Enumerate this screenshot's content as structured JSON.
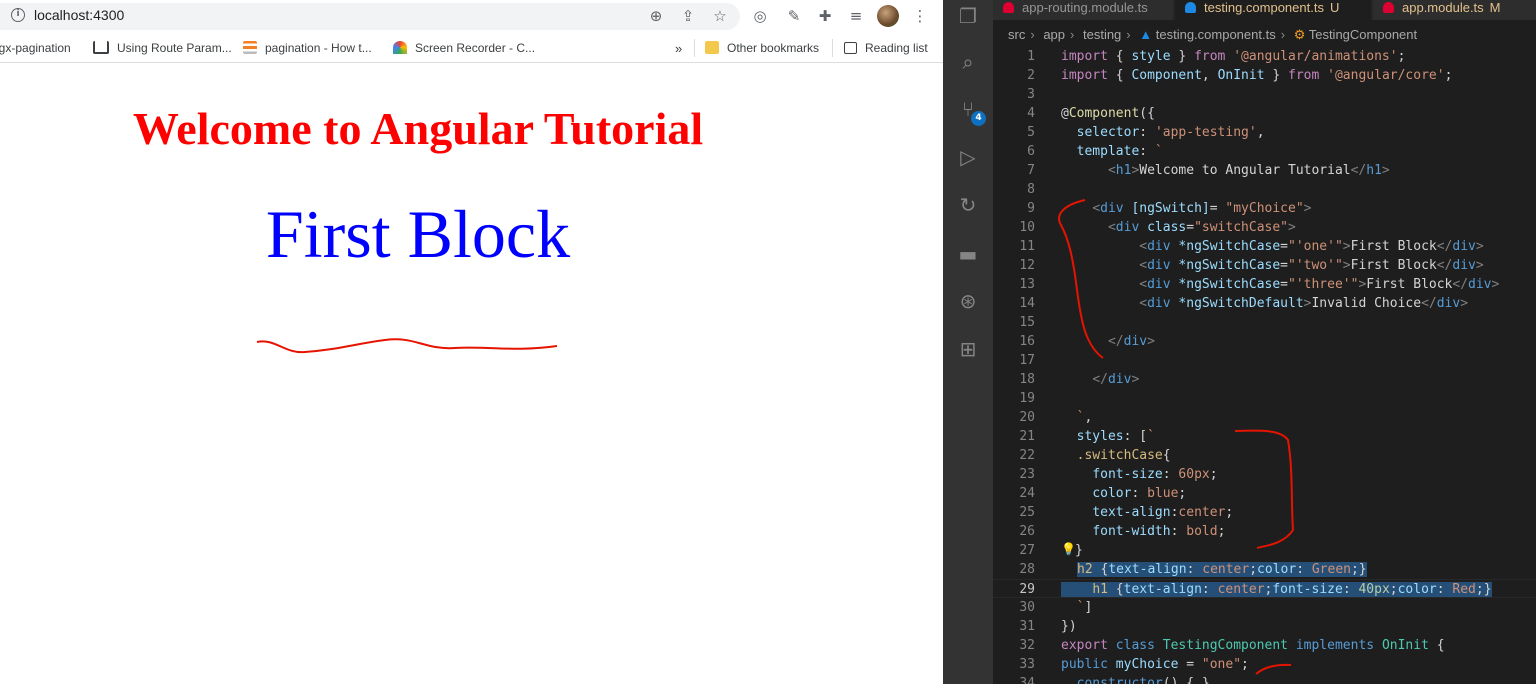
{
  "browser": {
    "url": "localhost:4300",
    "bookmarks": [
      {
        "label": "ngx-pagination",
        "icon": "angular-icon"
      },
      {
        "label": "Using Route Param...",
        "icon": "book-icon"
      },
      {
        "label": "pagination - How t...",
        "icon": "stackoverflow-icon"
      },
      {
        "label": "Screen Recorder - C...",
        "icon": "recorder-icon"
      }
    ],
    "overflow_chevron": "»",
    "other_bookmarks": "Other bookmarks",
    "reading_list": "Reading list",
    "page": {
      "heading": "Welcome to Angular Tutorial",
      "switch_case_text": "First Block"
    },
    "colors": {
      "heading": "#ff0000",
      "switch_case": "#0000ff"
    }
  },
  "editor": {
    "tabs": [
      {
        "label": "app-routing.module.ts",
        "flag": "",
        "active": false
      },
      {
        "label": "testing.component.ts",
        "flag": "U",
        "active": true
      },
      {
        "label": "app.module.ts",
        "flag": "M",
        "active": false
      }
    ],
    "breadcrumb": [
      "src",
      "app",
      "testing",
      "testing.component.ts",
      "TestingComponent"
    ],
    "scm_badge": "4",
    "current_line": 29,
    "line_numbers": [
      "1",
      "2",
      "3",
      "4",
      "5",
      "6",
      "7",
      "8",
      "9",
      "10",
      "11",
      "12",
      "13",
      "14",
      "15",
      "16",
      "17",
      "18",
      "19",
      "20",
      "21",
      "22",
      "23",
      "24",
      "25",
      "26",
      "27",
      "28",
      "29",
      "30",
      "31",
      "32",
      "33",
      "34"
    ],
    "code": {
      "l1": [
        "import",
        " { ",
        "style",
        " } ",
        "from",
        " ",
        "'@angular/animations'",
        ";"
      ],
      "l2": [
        "import",
        " { ",
        "Component",
        ", ",
        "OnInit",
        " } ",
        "from",
        " ",
        "'@angular/core'",
        ";"
      ],
      "l4": [
        "@",
        "Component",
        "({"
      ],
      "l5": [
        "selector",
        ": ",
        "'app-testing'",
        ","
      ],
      "l6": [
        "template",
        ": ",
        "`"
      ],
      "l7": [
        "<",
        "h1",
        ">",
        "Welcome to Angular Tutorial",
        "</",
        "h1",
        ">"
      ],
      "l9": [
        "<",
        "div",
        " ",
        "[ngSwitch]",
        "= ",
        "\"myChoice\"",
        ">"
      ],
      "l10": [
        "<",
        "div",
        " ",
        "class",
        "=",
        "\"switchCase\"",
        ">"
      ],
      "l11": [
        "<",
        "div",
        " ",
        "*ngSwitchCase",
        "=",
        "\"'one'\"",
        ">",
        "First Block",
        "</",
        "div",
        ">"
      ],
      "l12": [
        "<",
        "div",
        " ",
        "*ngSwitchCase",
        "=",
        "\"'two'\"",
        ">",
        "First Block",
        "</",
        "div",
        ">"
      ],
      "l13": [
        "<",
        "div",
        " ",
        "*ngSwitchCase",
        "=",
        "\"'three'\"",
        ">",
        "First Block",
        "</",
        "div",
        ">"
      ],
      "l14": [
        "<",
        "div",
        " ",
        "*ngSwitchDefault",
        ">",
        "Invalid Choice",
        "</",
        "div",
        ">"
      ],
      "l16": [
        "</",
        "div",
        ">"
      ],
      "l18": [
        "</",
        "div",
        ">"
      ],
      "l20": [
        "`",
        ","
      ],
      "l21": [
        "styles",
        ": [",
        "`"
      ],
      "l22": [
        ".switchCase",
        "{"
      ],
      "l23": [
        "font-size",
        ": ",
        "60px",
        ";"
      ],
      "l24": [
        "color",
        ": ",
        "blue",
        ";"
      ],
      "l25": [
        "text-align",
        ":",
        "center",
        ";"
      ],
      "l26": [
        "font-width",
        ": ",
        "bold",
        ";"
      ],
      "l27": [
        "}"
      ],
      "l28": [
        "h2",
        " {",
        "text-align",
        ": ",
        "center",
        ";",
        "color",
        ": ",
        "Green",
        ";}"
      ],
      "l29": [
        "h1",
        " {",
        "text-align",
        ": ",
        "center",
        ";",
        "font-size",
        ": ",
        "40px",
        ";",
        "color",
        ": ",
        "Red",
        ";}"
      ],
      "l30": [
        "`",
        "]"
      ],
      "l31": [
        "})"
      ],
      "l32": [
        "export",
        " ",
        "class",
        " ",
        "TestingComponent",
        " ",
        "implements",
        " ",
        "OnInit",
        " {"
      ],
      "l33": [
        "public",
        " ",
        "myChoice",
        " = ",
        "\"one\"",
        ";"
      ],
      "l34": [
        "constructor",
        "() { }"
      ]
    },
    "annotation_color": "#e51400"
  }
}
